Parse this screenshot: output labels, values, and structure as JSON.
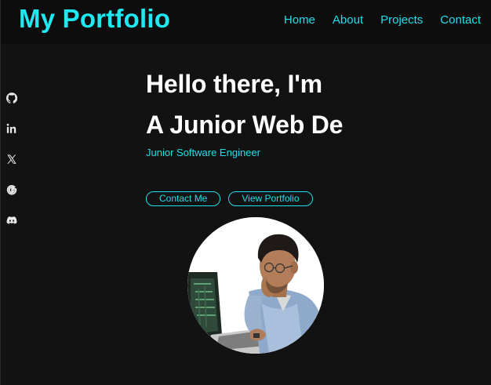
{
  "header": {
    "logo": "My Portfolio",
    "nav": [
      "Home",
      "About",
      "Projects",
      "Contact"
    ]
  },
  "social": [
    "github-icon",
    "linkedin-icon",
    "x-icon",
    "google-icon",
    "discord-icon"
  ],
  "hero": {
    "line1": "Hello there, I'm",
    "line2": "A Junior Web De",
    "subtitle": "Junior Software Engineer",
    "buttons": {
      "contact": "Contact Me",
      "portfolio": "View Portfolio"
    }
  },
  "colors": {
    "accent": "#1ee0ea",
    "background": "#121212",
    "heading": "#ffffff"
  }
}
